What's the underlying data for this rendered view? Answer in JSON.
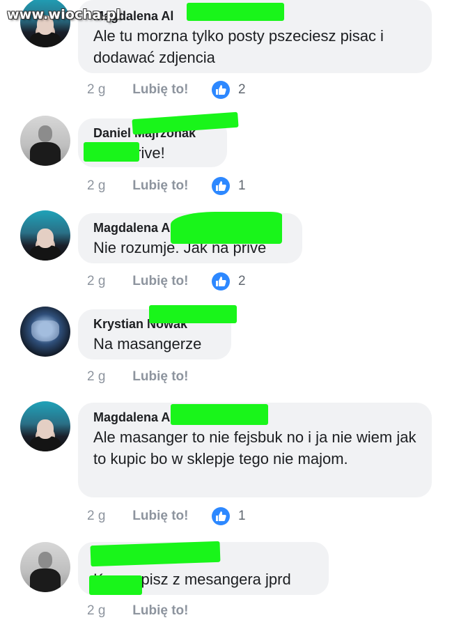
{
  "watermark": "www.wiocha.pl",
  "comments": [
    {
      "author": "Magdalena Al",
      "text": "Ale tu morzna tylko posty pszeciesz pisac i dodawać zdjencia",
      "time": "2 g",
      "like_label": "Lubię to!",
      "reactions": "2"
    },
    {
      "author": "Daniel Majrzonak",
      "text": "a na prive!",
      "time": "2 g",
      "like_label": "Lubię to!",
      "reactions": "1"
    },
    {
      "author": "Magdalena A",
      "text": "Nie rozumje. Jak na prive",
      "time": "2 g",
      "like_label": "Lubię to!",
      "reactions": "2"
    },
    {
      "author": "Krystian Nowak",
      "text": "Na masangerze",
      "time": "2 g",
      "like_label": "Lubię to!"
    },
    {
      "author": "Magdalena Aleksa",
      "text": "Ale masanger to nie  fejsbuk no i ja nie wiem jak to kupic bo w sklepje tego nie majom.",
      "time": "2 g",
      "like_label": "Lubię to!",
      "reactions": "1"
    },
    {
      "text": "Kurwa pisz z mesangera jprd",
      "time": "2 g",
      "like_label": "Lubię to!"
    }
  ],
  "colors": {
    "reaction": "#2d88ff",
    "censor": "#19f51a",
    "bubble": "#f1f2f4"
  },
  "icons": [
    "thumbs-up-icon"
  ]
}
